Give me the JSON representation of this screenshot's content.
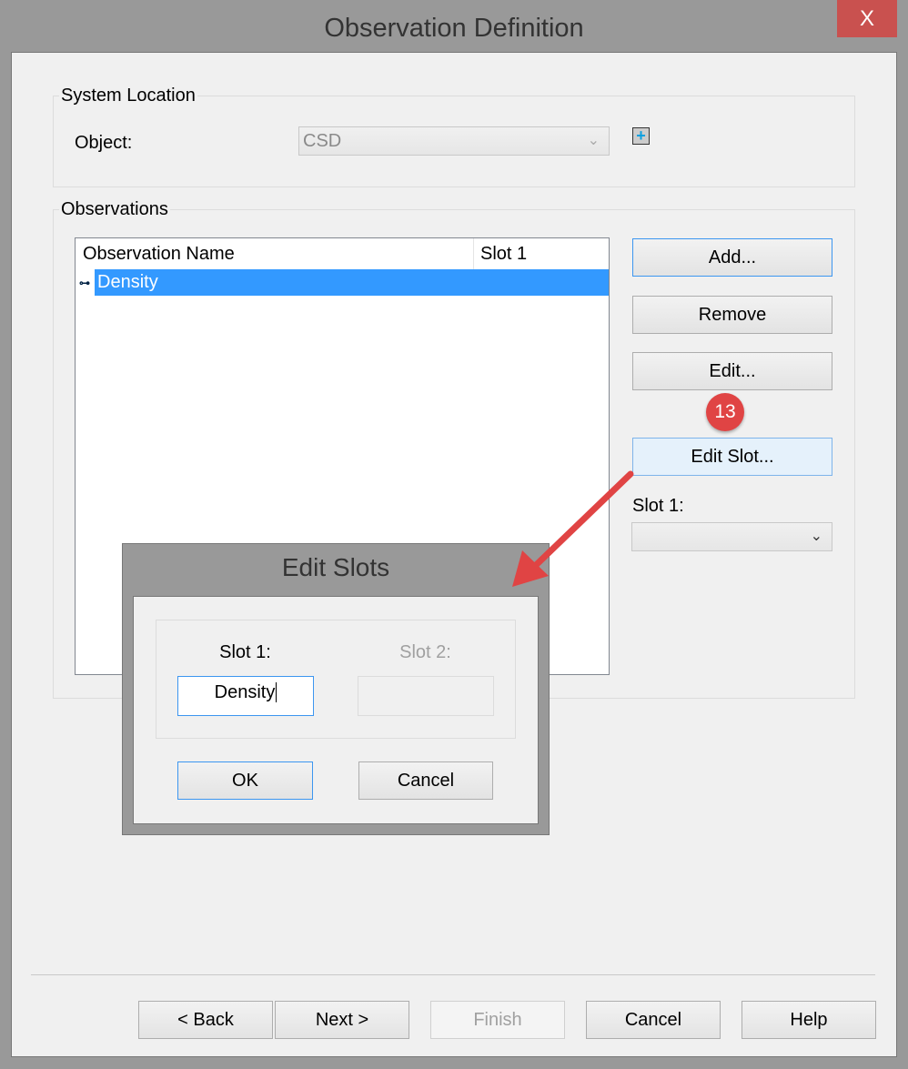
{
  "window": {
    "title": "Observation Definition",
    "close_label": "X"
  },
  "system_location": {
    "label": "System Location",
    "object_label": "Object:",
    "object_value": "CSD"
  },
  "observations": {
    "label": "Observations",
    "columns": [
      "Observation Name",
      "Slot 1"
    ],
    "rows": [
      {
        "name": "Density",
        "slot1": ""
      }
    ],
    "buttons": {
      "add": "Add...",
      "remove": "Remove",
      "edit": "Edit...",
      "edit_slot": "Edit Slot..."
    },
    "slot1_label": "Slot 1:",
    "slot1_value": ""
  },
  "annotation": {
    "step": "13",
    "color": "#e04444"
  },
  "footer": {
    "back": "< Back",
    "next": "Next >",
    "finish": "Finish",
    "cancel": "Cancel",
    "help": "Help"
  },
  "edit_slots": {
    "title": "Edit Slots",
    "slot1_label": "Slot 1:",
    "slot1_value": "Density",
    "slot2_label": "Slot 2:",
    "slot2_value": "",
    "ok": "OK",
    "cancel": "Cancel"
  }
}
